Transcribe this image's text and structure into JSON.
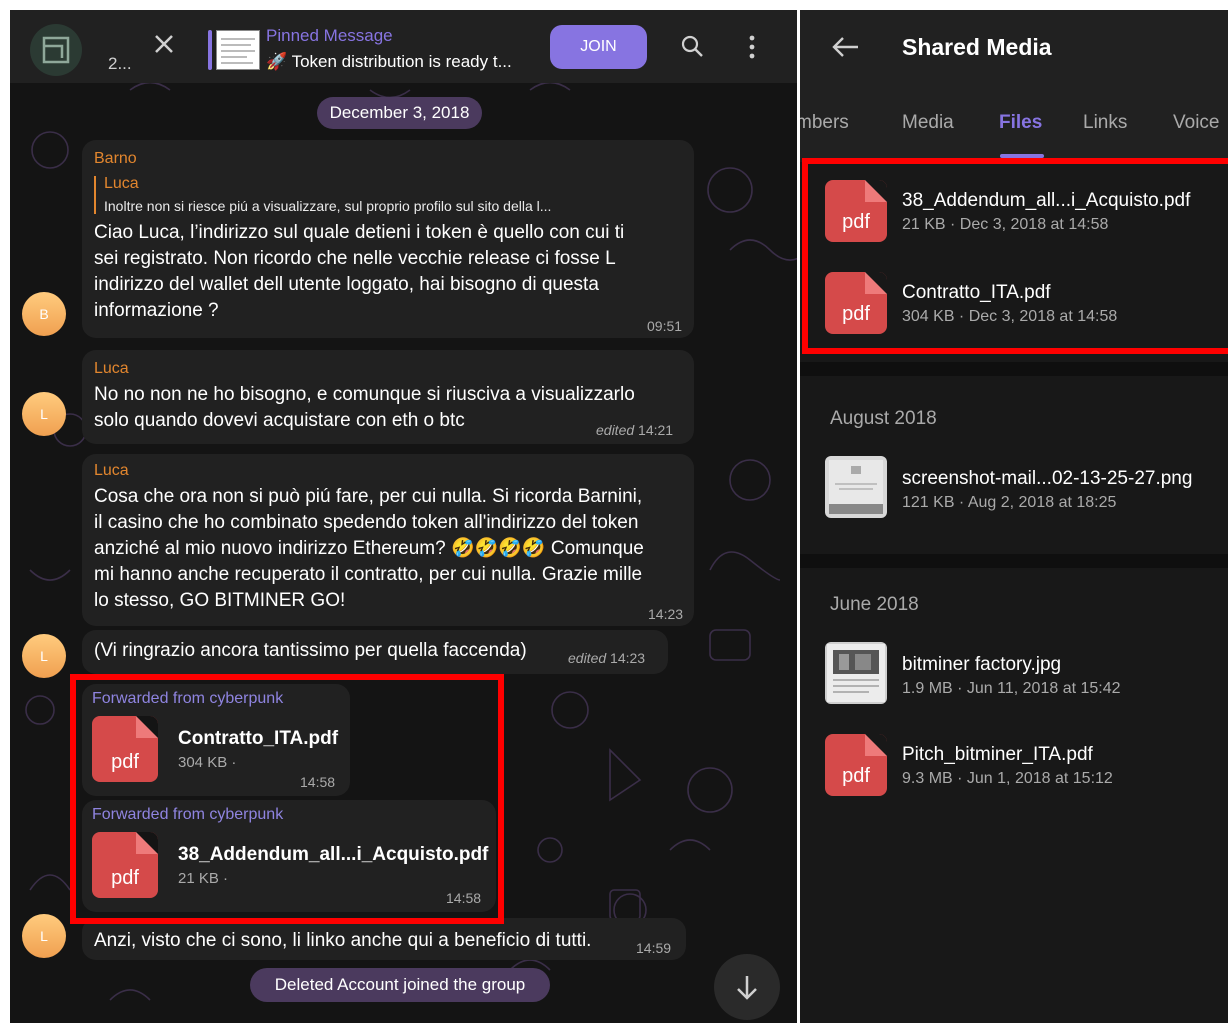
{
  "chat": {
    "header": {
      "member_count": "2...",
      "pinned_title": "Pinned Message",
      "pinned_text": "🚀 Token distribution is ready t...",
      "join_label": "JOIN"
    },
    "date_pill": "December 3, 2018",
    "messages": [
      {
        "avatar": "B",
        "sender": "Barno",
        "reply_sender": "Luca",
        "reply_text": "Inoltre non si riesce piú a visualizzare, sul proprio profilo sul sito della l...",
        "lines": [
          "Ciao Luca, l’indirizzo sul quale detieni i token è quello con cui ti",
          "sei registrato. Non ricordo che nelle vecchie release ci fosse L",
          "indirizzo del wallet dell utente loggato, hai bisogno di questa",
          "informazione ?"
        ],
        "time": "09:51"
      },
      {
        "avatar": "L",
        "sender": "Luca",
        "lines": [
          "No no non ne ho bisogno, e comunque si riusciva a visualizzarlo",
          "solo quando dovevi acquistare con eth o btc"
        ],
        "edited": "edited",
        "time": "14:21"
      },
      {
        "sender": "Luca",
        "lines": [
          "Cosa che ora non si può piú fare, per cui nulla. Si ricorda Barnini,",
          "il casino che ho combinato spedendo token all'indirizzo del token",
          "anziché al mio nuovo indirizzo Ethereum? 🤣🤣🤣🤣 Comunque",
          "mi hanno anche recuperato il contratto, per cui nulla. Grazie mille",
          "lo stesso, GO BITMINER GO!"
        ],
        "time": "14:23"
      },
      {
        "avatar": "L",
        "text": "(Vi ringrazio ancora tantissimo per quella faccenda)",
        "edited": "edited",
        "time": "14:23"
      }
    ],
    "forwards": [
      {
        "from": "Forwarded from cyberpunk",
        "icon_label": "pdf",
        "name": "Contratto_ITA.pdf",
        "size": "304 KB ·",
        "time": "14:58"
      },
      {
        "from": "Forwarded from cyberpunk",
        "icon_label": "pdf",
        "name": "38_Addendum_all...i_Acquisto.pdf",
        "size": "21 KB ·",
        "time": "14:58"
      }
    ],
    "last_message": {
      "avatar": "L",
      "text": "Anzi, visto che ci sono, li linko anche qui a beneficio di tutti.",
      "time": "14:59"
    },
    "service": "Deleted Account joined the group"
  },
  "media": {
    "title": "Shared Media",
    "tabs": [
      "mbers",
      "Media",
      "Files",
      "Links",
      "Voice"
    ],
    "active_tab": "Files",
    "files_top": [
      {
        "icon_label": "pdf",
        "name": "38_Addendum_all...i_Acquisto.pdf",
        "info": "21 KB · Dec 3, 2018 at 14:58"
      },
      {
        "icon_label": "pdf",
        "name": "Contratto_ITA.pdf",
        "info": "304 KB · Dec 3, 2018 at 14:58"
      }
    ],
    "sections": [
      {
        "title": "August 2018",
        "items": [
          {
            "name": "screenshot-mail...02-13-25-27.png",
            "info": "121 KB · Aug 2, 2018 at 18:25"
          }
        ]
      },
      {
        "title": "June 2018",
        "items": [
          {
            "name": "bitminer factory.jpg",
            "info": "1.9 MB · Jun 11, 2018 at 15:42"
          },
          {
            "icon_label": "pdf",
            "name": "Pitch_bitminer_ITA.pdf",
            "info": "9.3 MB · Jun 1, 2018 at 15:12"
          }
        ]
      }
    ]
  },
  "colors": {
    "accent": "#8774e1",
    "sender": "#e2862e",
    "pdf": "#d54a4a",
    "highlight": "#ff0000"
  }
}
